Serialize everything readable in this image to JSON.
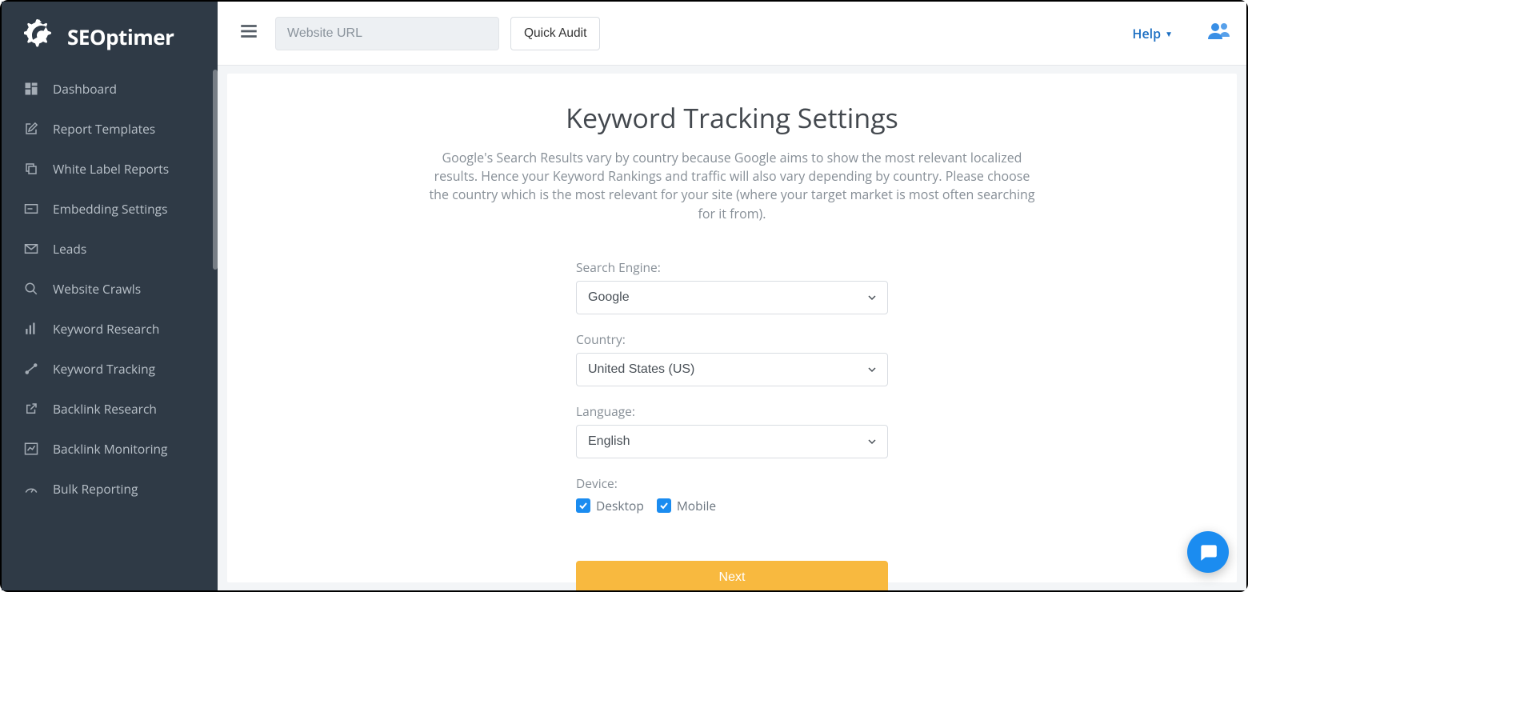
{
  "brand": {
    "name": "SEOptimer"
  },
  "sidebar": {
    "items": [
      {
        "label": "Dashboard"
      },
      {
        "label": "Report Templates"
      },
      {
        "label": "White Label Reports"
      },
      {
        "label": "Embedding Settings"
      },
      {
        "label": "Leads"
      },
      {
        "label": "Website Crawls"
      },
      {
        "label": "Keyword Research"
      },
      {
        "label": "Keyword Tracking"
      },
      {
        "label": "Backlink Research"
      },
      {
        "label": "Backlink Monitoring"
      },
      {
        "label": "Bulk Reporting"
      }
    ]
  },
  "topbar": {
    "url_placeholder": "Website URL",
    "quick_audit_label": "Quick Audit",
    "help_label": "Help"
  },
  "main": {
    "title": "Keyword Tracking Settings",
    "description": "Google's Search Results vary by country because Google aims to show the most relevant localized results. Hence your Keyword Rankings and traffic will also vary depending by country. Please choose the country which is the most relevant for your site (where your target market is most often searching for it from).",
    "labels": {
      "search_engine": "Search Engine:",
      "country": "Country:",
      "language": "Language:",
      "device": "Device:"
    },
    "values": {
      "search_engine": "Google",
      "country": "United States (US)",
      "language": "English",
      "desktop": "Desktop",
      "mobile": "Mobile"
    },
    "next_label": "Next"
  },
  "colors": {
    "sidebar_bg": "#2f3a46",
    "accent_blue": "#1b8cf0",
    "accent_orange": "#f8b93f",
    "link_blue": "#1b6ec2"
  }
}
